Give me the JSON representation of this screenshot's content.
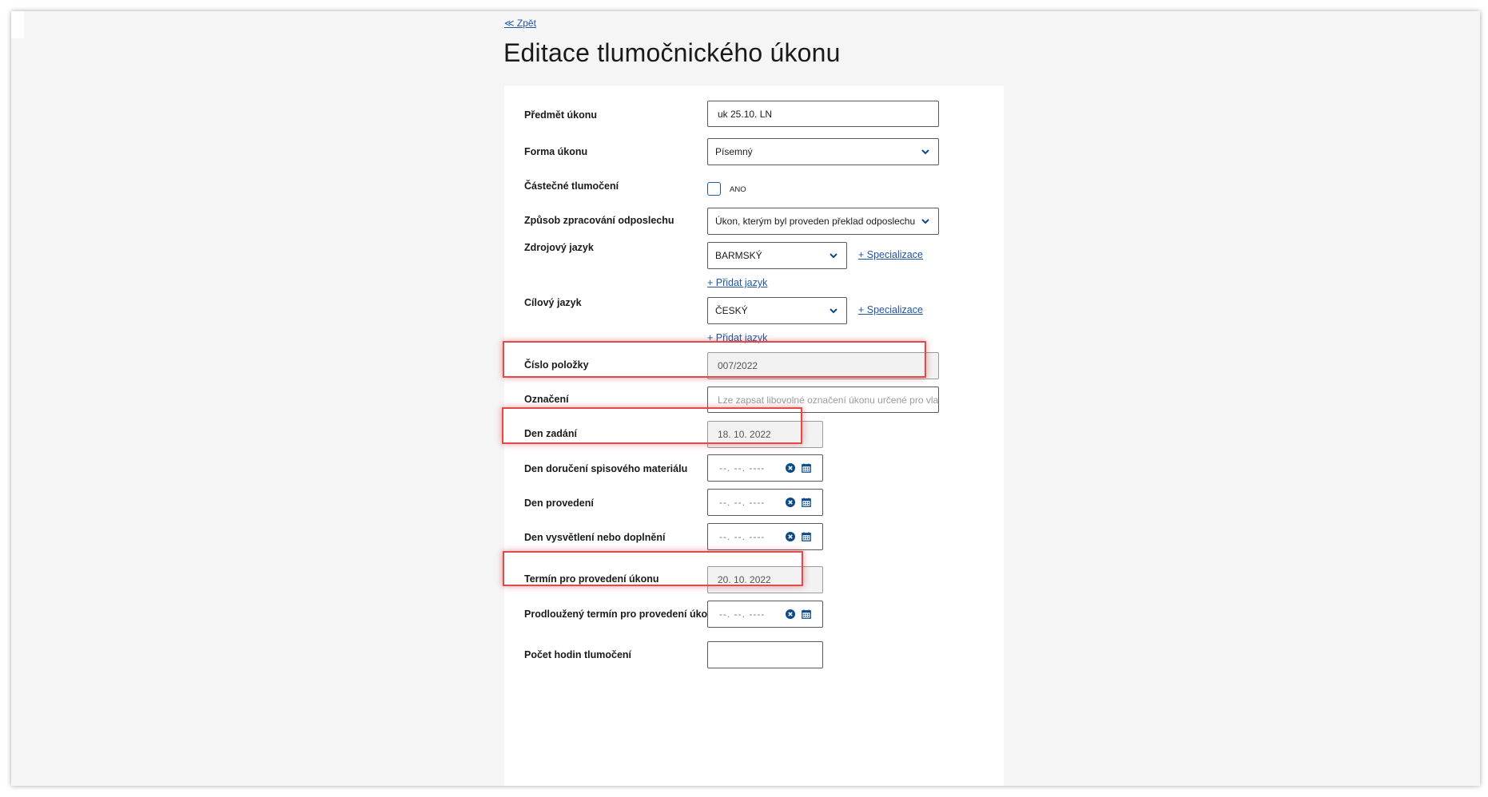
{
  "nav": {
    "back_label": "≪ Zpět"
  },
  "page": {
    "title": "Editace tlumočnického úkonu"
  },
  "form": {
    "predmet": {
      "label": "Předmět úkonu",
      "value": "uk 25.10. LN"
    },
    "forma": {
      "label": "Forma úkonu",
      "value": "Písemný"
    },
    "castecne": {
      "label": "Částečné tlumočení",
      "checkbox_label": "ANO",
      "checked": false
    },
    "zpusob": {
      "label": "Způsob zpracování odposlechu",
      "value": "Úkon, kterým byl proveden překlad odposlechu"
    },
    "zdrojovy": {
      "label": "Zdrojový jazyk",
      "value": "BARMSKÝ",
      "spec_link": "+ Specializace",
      "add_link": "+ Přidat jazyk"
    },
    "cilovy": {
      "label": "Cílový jazyk",
      "value": "ČESKÝ",
      "spec_link": "+ Specializace",
      "add_link": "+ Přidat jazyk"
    },
    "cislo": {
      "label": "Číslo položky",
      "value": "007/2022"
    },
    "oznaceni": {
      "label": "Označení",
      "placeholder": "Lze zapsat libovolné označení úkonu určené pro vlastní evi..."
    },
    "den_zadani": {
      "label": "Den zadání",
      "value": "18. 10. 2022"
    },
    "den_doruceni": {
      "label": "Den doručení spisového materiálu",
      "value": "--. --. ----"
    },
    "den_provedeni": {
      "label": "Den provedení",
      "value": "--. --. ----"
    },
    "den_vysvetleni": {
      "label": "Den vysvětlení nebo doplnění",
      "value": "--. --. ----"
    },
    "termin": {
      "label": "Termín pro provedení úkonu",
      "value": "20. 10. 2022"
    },
    "prodlouzeny": {
      "label": "Prodloužený termín pro provedení úkonu",
      "value": "--. --. ----"
    },
    "pocet_hodin": {
      "label": "Počet hodin tlumočení",
      "value": ""
    }
  },
  "colors": {
    "link": "#1f57a4",
    "highlight": "#e04a4a",
    "icon": "#0b4a8a"
  }
}
